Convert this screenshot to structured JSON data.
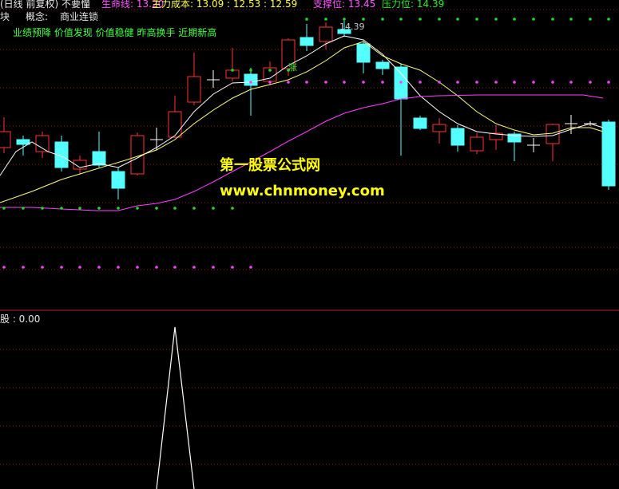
{
  "header": {
    "period_label": "(日线 前复权) 不要憧",
    "lifeline_label": "生命线: 13.20",
    "cost_label": "主力成本: 13.09 : 12.53 : 12.59",
    "support_label": "支撑位: 13.45",
    "pressure_label": "压力位: 14.39"
  },
  "info": {
    "block_label": "块",
    "concept_title": "概念:",
    "concept_value": "商业连锁",
    "tags": "业绩预降 价值发现 价值稳健 昨高换手 近期新高"
  },
  "annotations": {
    "high_price": "14.39",
    "rise_marker": "涨"
  },
  "watermark": {
    "site_name": "第一股票公式网",
    "site_url": "www.chnmoney.com"
  },
  "lower_panel": {
    "label": "股 : 0.00",
    "indicator_value": 0
  },
  "colors": {
    "up_candle": "#ff3232",
    "down_candle": "#54ffff",
    "ma_white": "#ffffff",
    "ma_yellow": "#ffff80",
    "ma_magenta": "#ff40ff",
    "grid": "#8b1a1a",
    "dot_green": "#22dd22",
    "dot_magenta": "#ff40ff",
    "panel_divider": "#c0202a"
  }
}
